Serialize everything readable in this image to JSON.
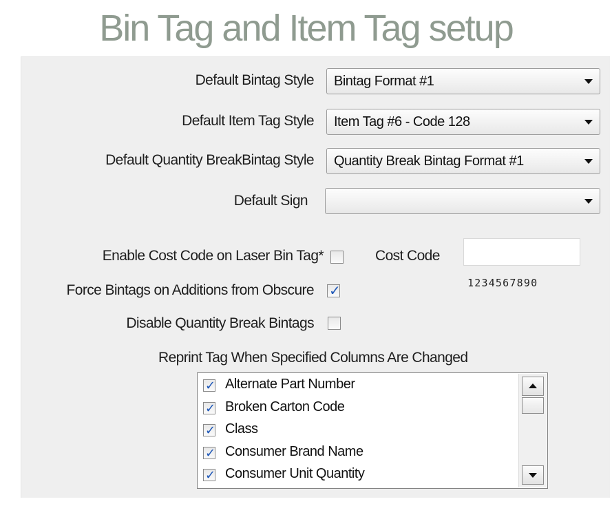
{
  "title": "Bin Tag and Item Tag setup",
  "fields": {
    "bintag_label": "Default Bintag Style",
    "bintag_value": "Bintag Format #1",
    "itemtag_label": "Default Item Tag Style",
    "itemtag_value": "Item Tag #6 - Code 128",
    "qtybreak_label": "Default Quantity BreakBintag Style",
    "qtybreak_value": "Quantity Break Bintag Format #1",
    "sign_label": "Default Sign",
    "sign_value": ""
  },
  "options": {
    "cost_code_enable_label": "Enable Cost Code on Laser Bin Tag*",
    "cost_code_enable_checked": false,
    "force_bintags_label": "Force Bintags on Additions from Obscure",
    "force_bintags_checked": true,
    "disable_qty_break_label": "Disable Quantity Break Bintags",
    "disable_qty_break_checked": false,
    "cost_code_label": "Cost Code",
    "cost_code_value": "",
    "cost_code_digits": "1234567890"
  },
  "reprint": {
    "label": "Reprint Tag When Specified Columns Are Changed",
    "items": [
      {
        "label": "Alternate Part Number",
        "checked": true
      },
      {
        "label": "Broken Carton Code",
        "checked": true
      },
      {
        "label": "Class",
        "checked": true
      },
      {
        "label": "Consumer Brand Name",
        "checked": true
      },
      {
        "label": "Consumer Unit Quantity",
        "checked": true
      }
    ]
  },
  "icons": {
    "dropdown": "chevron-down-icon",
    "check": "checkmark-icon",
    "scroll_up": "scroll-up-icon",
    "scroll_down": "scroll-down-icon"
  },
  "colors": {
    "title": "#8f9b90",
    "panel": "#efefef",
    "check": "#1f58b8"
  }
}
